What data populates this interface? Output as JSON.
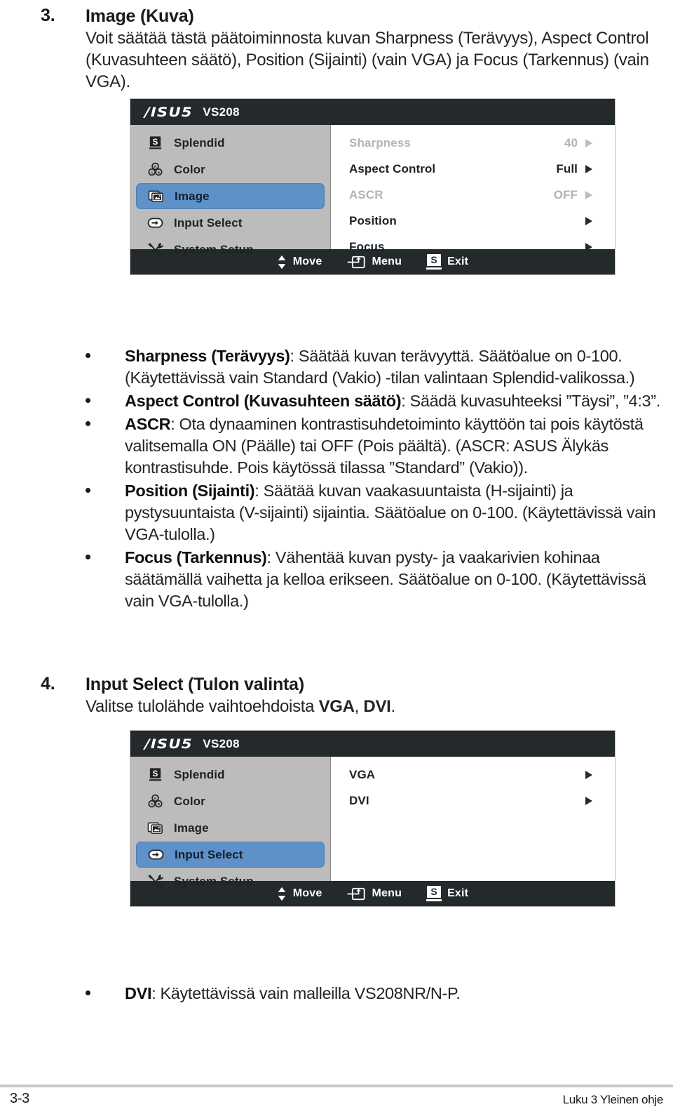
{
  "section3": {
    "number": "3.",
    "title": "Image (Kuva)",
    "paragraph": "Voit säätää tästä päätoiminnosta kuvan Sharpness (Terävyys), Aspect Control (Kuvasuhteen säätö), Position (Sijainti) (vain VGA) ja Focus (Tarkennus) (vain VGA)."
  },
  "osd_image": {
    "logo": "/ISUS",
    "model": "VS208",
    "sidebar": [
      {
        "label": "Splendid",
        "icon": "splendid-s-icon",
        "active": false
      },
      {
        "label": "Color",
        "icon": "color-rgb-icon",
        "active": false
      },
      {
        "label": "Image",
        "icon": "image-picture-icon",
        "active": true
      },
      {
        "label": "Input Select",
        "icon": "input-select-arrow-icon",
        "active": false
      },
      {
        "label": "System Setup",
        "icon": "system-setup-tools-icon",
        "active": false
      }
    ],
    "rows": [
      {
        "label": "Sharpness",
        "value": "40",
        "dim": true
      },
      {
        "label": "Aspect Control",
        "value": "Full",
        "dim": false
      },
      {
        "label": "ASCR",
        "value": "OFF",
        "dim": true
      },
      {
        "label": "Position",
        "value": "",
        "dim": false
      },
      {
        "label": "Focus",
        "value": "",
        "dim": false
      }
    ],
    "footer": [
      {
        "label": "Move",
        "icon": "updown-arrows-icon"
      },
      {
        "label": "Menu",
        "icon": "menu-enter-icon"
      },
      {
        "label": "Exit",
        "icon": "splendid-s-icon"
      }
    ]
  },
  "bullets_image": [
    {
      "bold": "Sharpness (Terävyys)",
      "text": ": Säätää kuvan terävyyttä. Säätöalue on 0-100. (Käytettävissä vain Standard (Vakio) -tilan valintaan Splendid-valikossa.)"
    },
    {
      "bold": "Aspect Control (Kuvasuhteen säätö)",
      "text": ": Säädä kuvasuhteeksi ”Täysi”, ”4:3”."
    },
    {
      "bold": "ASCR",
      "text": ": Ota dynaaminen kontrastisuhdetoiminto käyttöön tai pois käytöstä valitsemalla ON (Päälle) tai OFF (Pois päältä). (ASCR: ASUS Älykäs kontrastisuhde. Pois käytössä tilassa ”Standard” (Vakio))."
    },
    {
      "bold": "Position (Sijainti)",
      "text": ": Säätää kuvan vaakasuuntaista (H-sijainti) ja pystysuuntaista (V-sijainti) sijaintia. Säätöalue on 0-100. (Käytettävissä vain VGA-tulolla.)"
    },
    {
      "bold": "Focus (Tarkennus)",
      "text": ": Vähentää kuvan pysty- ja vaakarivien kohinaa säätämällä vaihetta ja kelloa erikseen. Säätöalue on 0-100. (Käytettävissä vain VGA-tulolla.)"
    }
  ],
  "section4": {
    "number": "4.",
    "title": "Input Select (Tulon valinta)",
    "paragraph_pre": "Valitse tulolähde vaihtoehdoista ",
    "paragraph_bold1": "VGA",
    "paragraph_mid": ", ",
    "paragraph_bold2": "DVI",
    "paragraph_post": "."
  },
  "osd_input": {
    "logo": "/ISUS",
    "model": "VS208",
    "sidebar": [
      {
        "label": "Splendid",
        "icon": "splendid-s-icon",
        "active": false
      },
      {
        "label": "Color",
        "icon": "color-rgb-icon",
        "active": false
      },
      {
        "label": "Image",
        "icon": "image-picture-icon",
        "active": false
      },
      {
        "label": "Input Select",
        "icon": "input-select-arrow-icon",
        "active": true
      },
      {
        "label": "System Setup",
        "icon": "system-setup-tools-icon",
        "active": false
      }
    ],
    "rows": [
      {
        "label": "VGA",
        "value": "",
        "dim": false
      },
      {
        "label": "DVI",
        "value": "",
        "dim": false
      }
    ],
    "footer": [
      {
        "label": "Move",
        "icon": "updown-arrows-icon"
      },
      {
        "label": "Menu",
        "icon": "menu-enter-icon"
      },
      {
        "label": "Exit",
        "icon": "splendid-s-icon"
      }
    ]
  },
  "bullets_input": [
    {
      "bold": "DVI",
      "text": ": Käytettävissä vain malleilla VS208NR/N-P."
    }
  ],
  "page_footer": {
    "page": "3-3",
    "chapter": "Luku 3 Yleinen ohje"
  },
  "colors": {
    "osd_titlebar": "#24292b",
    "osd_sidebar": "#bcbcbc",
    "highlight": "#5e91c8",
    "dim_text": "#b3b3b3"
  }
}
